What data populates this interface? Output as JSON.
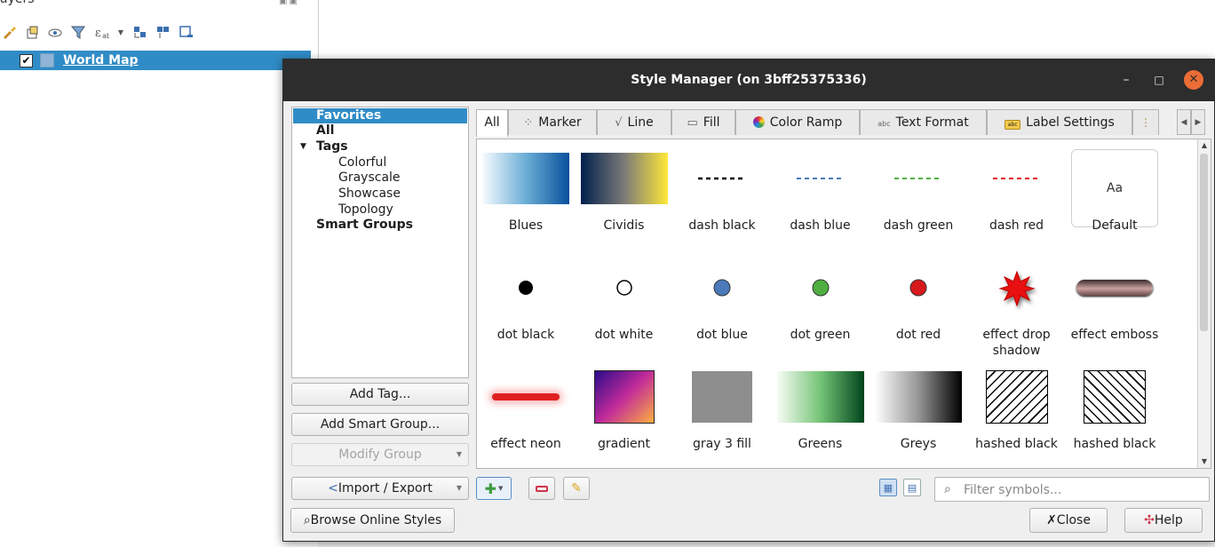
{
  "layers_panel": {
    "title": "ayers",
    "layer_name": "World Map",
    "layer_checked": "✔"
  },
  "dialog": {
    "title": "Style Manager (on 3bff25375336)",
    "minimize": "–",
    "maximize": "□",
    "close": "✕"
  },
  "tree": {
    "favorites": "Favorites",
    "all": "All",
    "tags": "Tags",
    "tag_items": [
      "Colorful",
      "Grayscale",
      "Showcase",
      "Topology"
    ],
    "smart_groups": "Smart Groups"
  },
  "left_buttons": {
    "add_tag": "Add Tag...",
    "add_smart_group": "Add Smart Group...",
    "modify_group": "Modify Group",
    "import_export": "Import / Export",
    "browse_online": "Browse Online Styles"
  },
  "tabs": [
    "All",
    "Marker",
    "Line",
    "Fill",
    "Color Ramp",
    "Text Format",
    "Label Settings"
  ],
  "symbols": [
    "Blues",
    "Cividis",
    "dash  black",
    "dash blue",
    "dash green",
    "dash red",
    "Default",
    "dot  black",
    "dot  white",
    "dot blue",
    "dot green",
    "dot red",
    "effect drop shadow",
    "effect emboss",
    "effect neon",
    "gradient",
    "gray 3 fill",
    "Greens",
    "Greys",
    "hashed black",
    "hashed black"
  ],
  "default_preview_text": "Aa",
  "filter": {
    "placeholder": "Filter symbols..."
  },
  "bottom_buttons": {
    "close": "Close",
    "help": "Help"
  },
  "colors": {
    "selection": "#308cc6",
    "titlebar": "#2d2d2d",
    "close_button": "#ec6c35",
    "dot_blue": "#4a7ab9",
    "dot_green": "#4fae3f",
    "dot_red": "#d7191c"
  }
}
